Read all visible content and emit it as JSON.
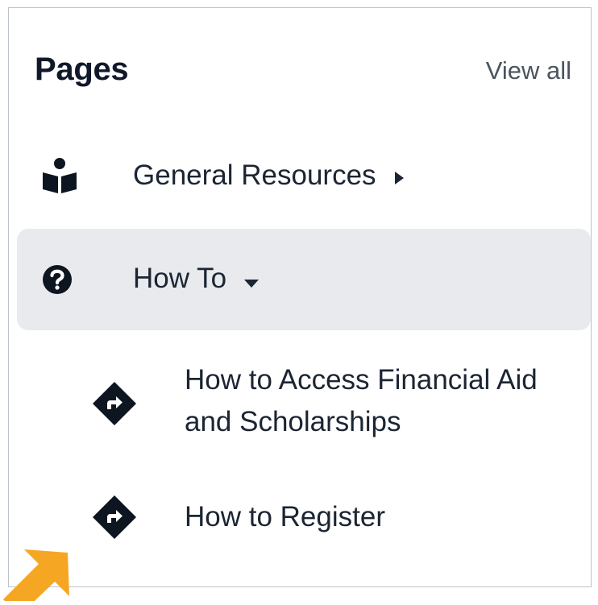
{
  "panel": {
    "title": "Pages",
    "view_all_label": "View all"
  },
  "nav": {
    "items": [
      {
        "label": "General Resources",
        "icon": "book-reader-icon",
        "caret": "caret-right-icon",
        "expanded": false,
        "active": false
      },
      {
        "label": "How To",
        "icon": "question-circle-icon",
        "caret": "caret-down-icon",
        "expanded": true,
        "active": true
      }
    ],
    "sub_items": [
      {
        "label": "How to Access Financial Aid and Scholarships",
        "icon": "directions-sign-icon"
      },
      {
        "label": "How to Register",
        "icon": "directions-sign-icon"
      }
    ]
  },
  "colors": {
    "text": "#1b2533",
    "title": "#10192a",
    "muted": "#4b5560",
    "active_bg": "#e8eaee",
    "border": "#bdc3ca",
    "pointer_arrow": "#f5a623"
  }
}
